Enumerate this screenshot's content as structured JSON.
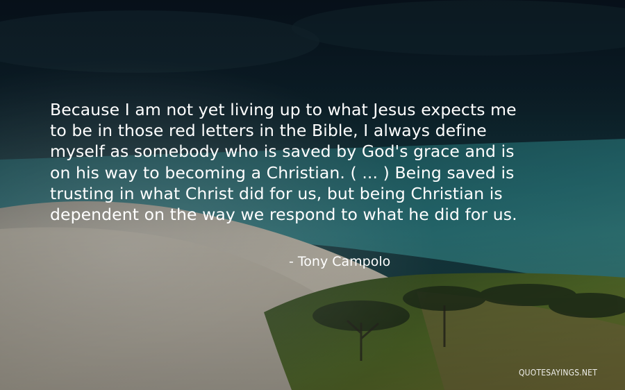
{
  "quote": {
    "lines": [
      "Because I am not yet living up to what Jesus expects me",
      "to be in those red letters in the Bible, I always define",
      "myself as somebody who is saved by God's grace and is",
      "on his way to becoming a Christian. ( ... ) Being saved is",
      "trusting in what Christ did for us, but being Christian is",
      "dependent on the way we respond to what he did for us."
    ]
  },
  "author": "- Tony Campolo",
  "watermark": "QUOTESAYINGS.NET",
  "colors": {
    "text": "#ffffff",
    "sky_top": "#0b1d2a",
    "sea": "#1e6a72",
    "sand": "#d9d2c4",
    "grass": "#5f7a2c"
  }
}
